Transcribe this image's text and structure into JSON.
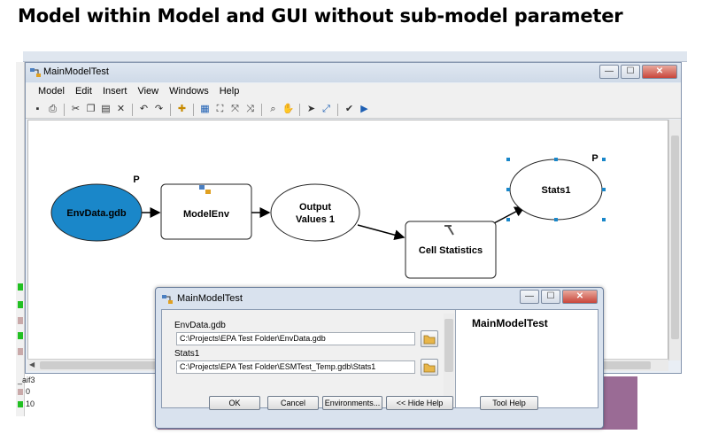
{
  "slide": {
    "title": "Model within Model and GUI without sub-model parameter"
  },
  "background": {
    "legend": [
      {
        "label": "0",
        "color": "#c9a9a9"
      },
      {
        "label": "10",
        "color": "#22c022"
      }
    ],
    "layer_label": "_aif3"
  },
  "window": {
    "title": "MainModelTest",
    "menu": [
      "Model",
      "Edit",
      "Insert",
      "View",
      "Windows",
      "Help"
    ]
  },
  "diagram": {
    "nodes": [
      {
        "id": "envdata",
        "label": "EnvData.gdb",
        "shape": "ellipse",
        "fill": "#1a87c9",
        "param_marker": "P"
      },
      {
        "id": "modelenv",
        "label": "ModelEnv",
        "shape": "rect",
        "fill": "#ffffff"
      },
      {
        "id": "output",
        "label_lines": [
          "Output",
          "Values 1"
        ],
        "shape": "ellipse",
        "fill": "#ffffff"
      },
      {
        "id": "cellstats",
        "label": "Cell Statistics",
        "shape": "rect",
        "fill": "#ffffff"
      },
      {
        "id": "stats1",
        "label": "Stats1",
        "shape": "ellipse",
        "fill": "#ffffff",
        "param_marker": "P"
      }
    ]
  },
  "dialog": {
    "title": "MainModelTest",
    "fields": [
      {
        "label": "EnvData.gdb",
        "value": "C:\\Projects\\EPA Test Folder\\EnvData.gdb"
      },
      {
        "label": "Stats1",
        "value": "C:\\Projects\\EPA Test Folder\\ESMTest_Temp.gdb\\Stats1"
      }
    ],
    "help_title": "MainModelTest",
    "buttons": [
      "OK",
      "Cancel",
      "Environments...",
      "<< Hide Help",
      "Tool Help"
    ]
  }
}
